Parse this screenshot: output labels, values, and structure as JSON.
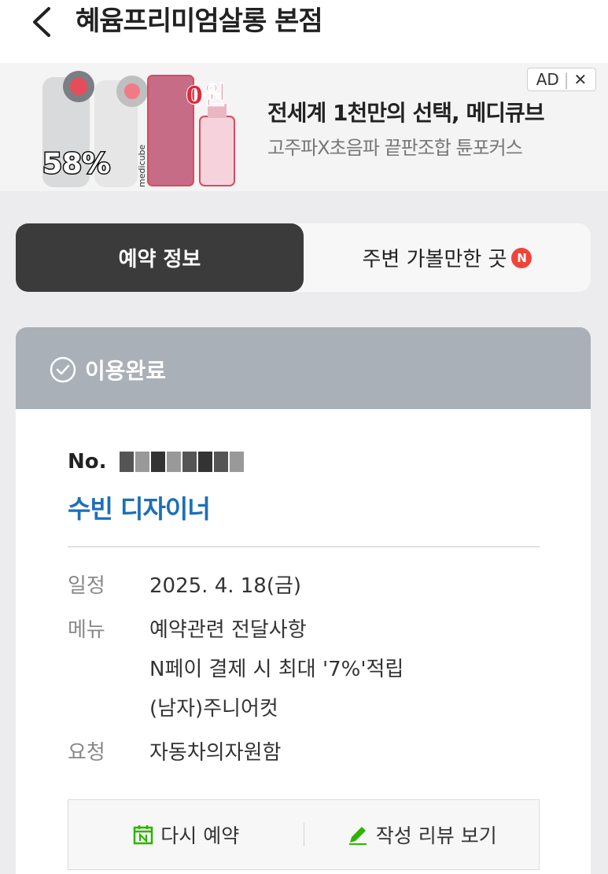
{
  "header": {
    "title": "혜윰프리미엄살롱 본점"
  },
  "ad": {
    "close_label": "AD",
    "close_x": "✕",
    "title": "전세계 1천만의 선택, 메디큐브",
    "subtitle": "고주파X초음파 끝판조합 튠포커스",
    "image_badges": {
      "discount": "58%",
      "price": "0원",
      "brand": "medicube"
    }
  },
  "tabs": [
    {
      "label": "예약 정보",
      "active": true
    },
    {
      "label": "주변 가볼만한 곳",
      "badge": "N",
      "active": false
    }
  ],
  "status": {
    "label": "이용완료"
  },
  "booking": {
    "number_prefix": "No.",
    "designer": "수빈 디자이너",
    "schedule_label": "일정",
    "schedule_value": "2025. 4. 18(금)",
    "menu_label": "메뉴",
    "menu_items": [
      "예약관련 전달사항",
      "N페이 결제 시 최대 '7%'적립",
      "(남자)주니어컷"
    ],
    "request_label": "요청",
    "request_value": "자동차의자원함"
  },
  "actions": {
    "rebook_label": "다시 예약",
    "review_label": "작성 리뷰 보기"
  },
  "colors": {
    "accent_blue": "#1d6fb8",
    "tab_active_bg": "#3b3b3c",
    "status_bg": "#a9b0b8",
    "badge_red": "#f04438",
    "icon_green": "#2db400"
  }
}
